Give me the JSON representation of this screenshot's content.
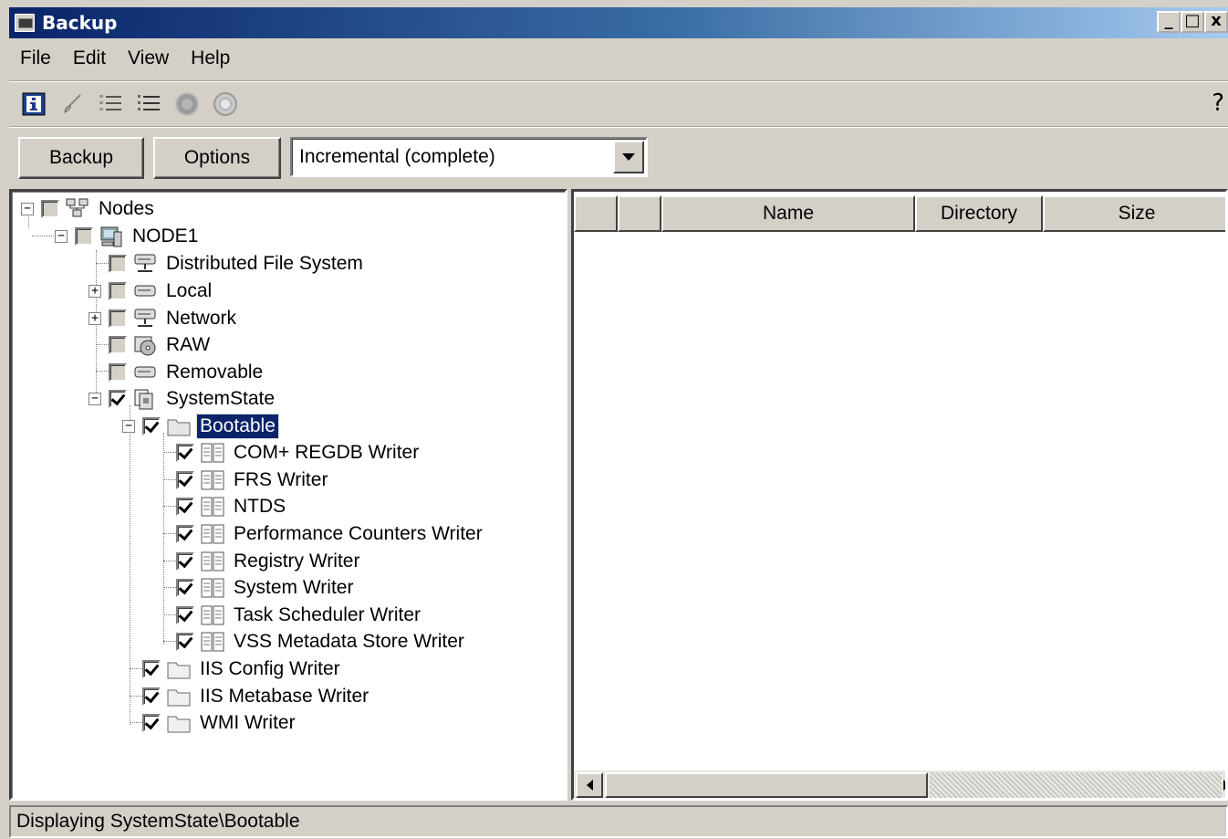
{
  "window": {
    "title": "Backup",
    "controls": [
      "_",
      "□",
      "x"
    ]
  },
  "menu": [
    "File",
    "Edit",
    "View",
    "Help"
  ],
  "toolbar": {
    "icons": [
      "info-icon",
      "brush-icon",
      "numbered-list-icon",
      "checklist-icon",
      "filled-disc-icon",
      "hollow-disc-icon"
    ],
    "help": "help-icon"
  },
  "actions": {
    "backup_label": "Backup",
    "options_label": "Options",
    "mode_value": "Incremental (complete)"
  },
  "tree": {
    "root": "Nodes",
    "node": "NODE1",
    "items": [
      {
        "label": "Distributed File System",
        "icon": "network-drive-icon"
      },
      {
        "label": "Local",
        "icon": "drive-icon"
      },
      {
        "label": "Network",
        "icon": "network-drive-icon"
      },
      {
        "label": "RAW",
        "icon": "raw-disk-icon"
      },
      {
        "label": "Removable",
        "icon": "drive-icon"
      },
      {
        "label": "SystemState",
        "icon": "system-state-icon"
      }
    ],
    "bootable": "Bootable",
    "writers": [
      "COM+ REGDB Writer",
      "FRS Writer",
      "NTDS",
      "Performance Counters Writer",
      "Registry Writer",
      "System Writer",
      "Task Scheduler Writer",
      "VSS Metadata Store Writer"
    ],
    "other_writers": [
      "IIS Config Writer",
      "IIS Metabase Writer",
      "WMI Writer"
    ]
  },
  "detail": {
    "columns": [
      "",
      "",
      "Name",
      "Directory",
      "Size"
    ]
  },
  "status": "Displaying SystemState\\Bootable",
  "colors": {
    "title_start": "#0a246a",
    "title_end": "#a6caf0",
    "selection": "#0a246a",
    "face": "#d4d0c8"
  }
}
